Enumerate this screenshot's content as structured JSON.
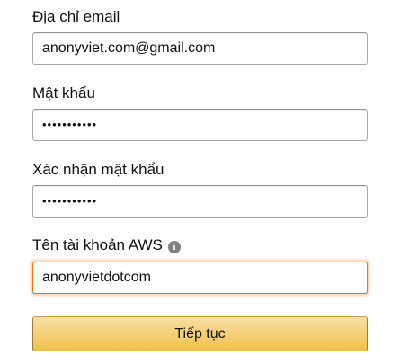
{
  "form": {
    "email": {
      "label": "Địa chỉ email",
      "value": "anonyviet.com@gmail.com"
    },
    "password": {
      "label": "Mật khẩu",
      "value": "•••••••••••"
    },
    "confirm_password": {
      "label": "Xác nhận mật khẩu",
      "value": "•••••••••••"
    },
    "account_name": {
      "label": "Tên tài khoản AWS",
      "info_icon": "i",
      "value": "anonyvietdotcom"
    },
    "submit_label": "Tiếp tục"
  },
  "colors": {
    "button_gradient_top": "#f7dfa5",
    "button_gradient_bottom": "#f0c14b",
    "focus_border": "#e77600",
    "input_border": "#a6a6a6",
    "info_icon": "#808080"
  }
}
